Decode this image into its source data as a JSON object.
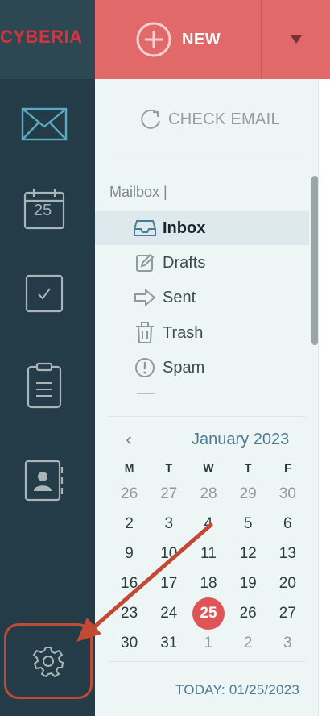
{
  "brand": {
    "name": "CYBERIA"
  },
  "toolbar": {
    "new_label": "NEW"
  },
  "nav": {
    "icons": [
      "mail-icon",
      "calendar-icon",
      "tasks-icon",
      "notes-icon",
      "contacts-icon",
      "settings-icon"
    ],
    "calendar_day": "25"
  },
  "panel": {
    "check_email_label": "CHECK EMAIL",
    "mailbox_label": "Mailbox |",
    "folders": [
      {
        "label": "Inbox",
        "icon": "inbox-icon"
      },
      {
        "label": "Drafts",
        "icon": "drafts-icon"
      },
      {
        "label": "Sent",
        "icon": "sent-icon"
      },
      {
        "label": "Trash",
        "icon": "trash-icon"
      },
      {
        "label": "Spam",
        "icon": "spam-icon"
      }
    ]
  },
  "calendar": {
    "month_label": "January 2023",
    "prev_symbol": "‹",
    "weekdays": [
      "M",
      "T",
      "W",
      "T",
      "F"
    ],
    "days": [
      [
        "26",
        "27",
        "28",
        "29",
        "30"
      ],
      [
        "2",
        "3",
        "4",
        "5",
        "6"
      ],
      [
        "9",
        "10",
        "11",
        "12",
        "13"
      ],
      [
        "16",
        "17",
        "18",
        "19",
        "20"
      ],
      [
        "23",
        "24",
        "25",
        "26",
        "27"
      ],
      [
        "30",
        "31",
        "1",
        "2",
        "3"
      ]
    ],
    "muted": [
      [
        true,
        true,
        true,
        true,
        true
      ],
      [
        false,
        false,
        false,
        false,
        false
      ],
      [
        false,
        false,
        false,
        false,
        false
      ],
      [
        false,
        false,
        false,
        false,
        false
      ],
      [
        false,
        false,
        false,
        false,
        false
      ],
      [
        false,
        false,
        true,
        true,
        true
      ]
    ],
    "today_label": "TODAY: 01/25/2023"
  },
  "colors": {
    "rail": "#233c47",
    "accent_red": "#e2696a",
    "today_bubble": "#e05458",
    "link_blue": "#4a7c95",
    "annotation": "#c24a35"
  }
}
